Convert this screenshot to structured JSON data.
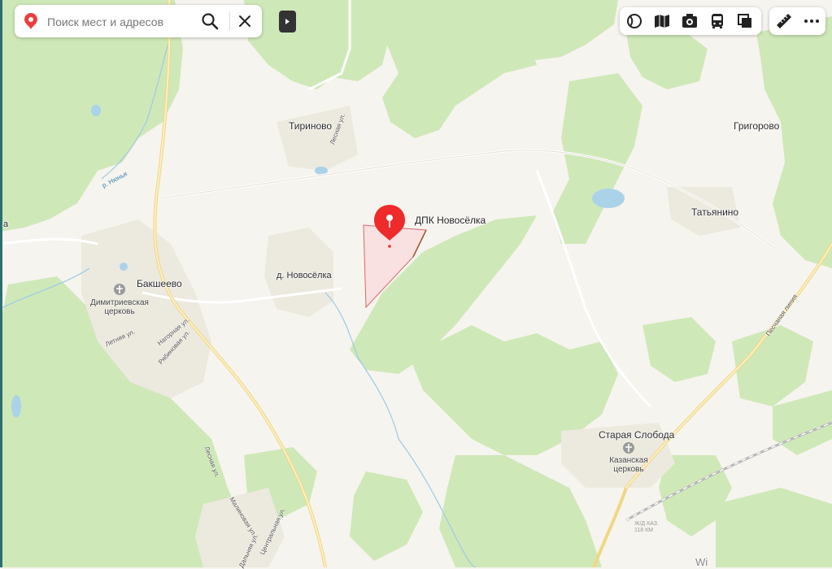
{
  "search": {
    "placeholder": "Поиск мест и адресов",
    "value": ""
  },
  "icons": {
    "search_pin": "location-pin-icon",
    "search": "magnifier-icon",
    "close": "close-icon",
    "collapse": "play-triangle-icon",
    "layers": [
      "panorama-sphere-icon",
      "map-book-icon",
      "camera-icon",
      "bus-icon",
      "layers-square-icon"
    ],
    "tools": [
      "ruler-icon",
      "more-dots-icon"
    ]
  },
  "colors": {
    "map_background": "#f6f4ee",
    "forest": "#cde8b5",
    "road_major": "#f3dc8f",
    "water": "#aad3ea",
    "selected_area": "#f8dddd",
    "marker": "#ee2a2a"
  },
  "selected_place": {
    "name": "ДПК Новосёлка"
  },
  "labels": {
    "tirinovo": "Тириново",
    "lesnaya_top": "Лесная ул.",
    "grigorovo": "Григорово",
    "tatyanino": "Татьянино",
    "r_nyunya": "р. Нюнья",
    "bakshevo": "Бакшеево",
    "church_bakshevo": "Димитриевская церковь",
    "church_bakshevo_l1": "Димитриевская",
    "church_bakshevo_l2": "церковь",
    "d_novoselka": "д. Новосёлка",
    "letnyaya": "Летняя ул.",
    "nagornaya": "Нагорная ул.",
    "ryabinovaya": "Рябиновая ул.",
    "lesnaya_bottom": "Лесная ул.",
    "malinovaya": "Малиновая ул.",
    "tsentralnaya": "Центральная ул.",
    "dalnaya": "Дальняя ул.",
    "peschanaya": "Песчаная линия",
    "staraya_sloboda": "Старая Слобода",
    "church_sloboda_l1": "Казанская",
    "church_sloboda_l2": "церковь",
    "station_l1": "Ж/Д КАЗ.",
    "station_l2": "118 КМ",
    "edge_left": "а",
    "edge_bottom": "Wi"
  }
}
